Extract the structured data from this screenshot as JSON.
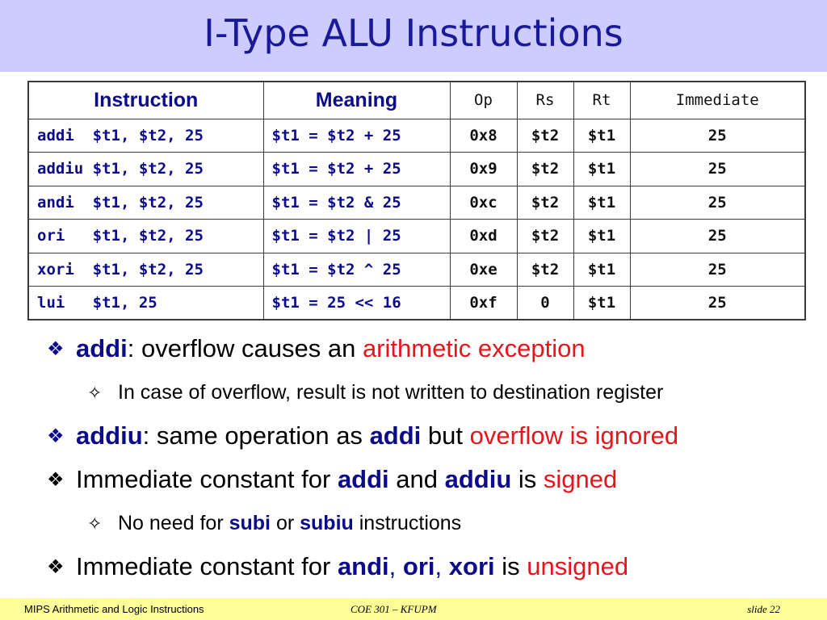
{
  "slide": {
    "title": "I-Type ALU Instructions"
  },
  "table": {
    "headers": [
      "Instruction",
      "Meaning",
      "Op",
      "Rs",
      "Rt",
      "Immediate"
    ],
    "rows": [
      {
        "instruction": "addi  $t1, $t2, 25",
        "meaning": "$t1 = $t2 + 25",
        "op": "0x8",
        "rs": "$t2",
        "rt": "$t1",
        "immediate": "25"
      },
      {
        "instruction": "addiu $t1, $t2, 25",
        "meaning": "$t1 = $t2 + 25",
        "op": "0x9",
        "rs": "$t2",
        "rt": "$t1",
        "immediate": "25"
      },
      {
        "instruction": "andi  $t1, $t2, 25",
        "meaning": "$t1 = $t2 & 25",
        "op": "0xc",
        "rs": "$t2",
        "rt": "$t1",
        "immediate": "25"
      },
      {
        "instruction": "ori   $t1, $t2, 25",
        "meaning": "$t1 = $t2 | 25",
        "op": "0xd",
        "rs": "$t2",
        "rt": "$t1",
        "immediate": "25"
      },
      {
        "instruction": "xori  $t1, $t2, 25",
        "meaning": "$t1 = $t2 ^ 25",
        "op": "0xe",
        "rs": "$t2",
        "rt": "$t1",
        "immediate": "25"
      },
      {
        "instruction": "lui   $t1, 25",
        "meaning": "$t1 = 25 << 16",
        "op": "0xf",
        "rs": "0",
        "rt": "$t1",
        "immediate": "25"
      }
    ]
  },
  "bullets": {
    "glyph": "❖",
    "sub_glyph": "✧",
    "b1": {
      "kw": "addi",
      "text": ": overflow causes an ",
      "red": "arithmetic exception"
    },
    "b1_sub": {
      "text": "In case of overflow, result is not written to destination register"
    },
    "b2": {
      "kw": "addiu",
      "text1": ": same operation as ",
      "kw2": "addi",
      "text2": " but ",
      "red": "overflow is ignored"
    },
    "b3": {
      "text1": "Immediate constant for ",
      "kw1": "addi",
      "text2": " and ",
      "kw2": "addiu",
      "text3": " is ",
      "red": "signed"
    },
    "b3_sub": {
      "text1": "No need for ",
      "kw1": "subi",
      "text2": " or ",
      "kw2": "subiu",
      "text3": " instructions"
    },
    "b4": {
      "text1": "Immediate constant for ",
      "kw1": "andi",
      "sep1": ", ",
      "kw2": "ori",
      "sep2": ", ",
      "kw3": "xori",
      "text2": " is ",
      "red": "unsigned"
    }
  },
  "footer": {
    "left": "MIPS Arithmetic and Logic Instructions",
    "center": "COE 301 – KFUPM",
    "right": "slide 22"
  },
  "colors": {
    "title_bar": "#ccccff",
    "title_text": "#1a1a99",
    "keyword": "#0b0b8c",
    "emphasis_red": "#e8141c",
    "footer_bg": "#ffff99"
  }
}
